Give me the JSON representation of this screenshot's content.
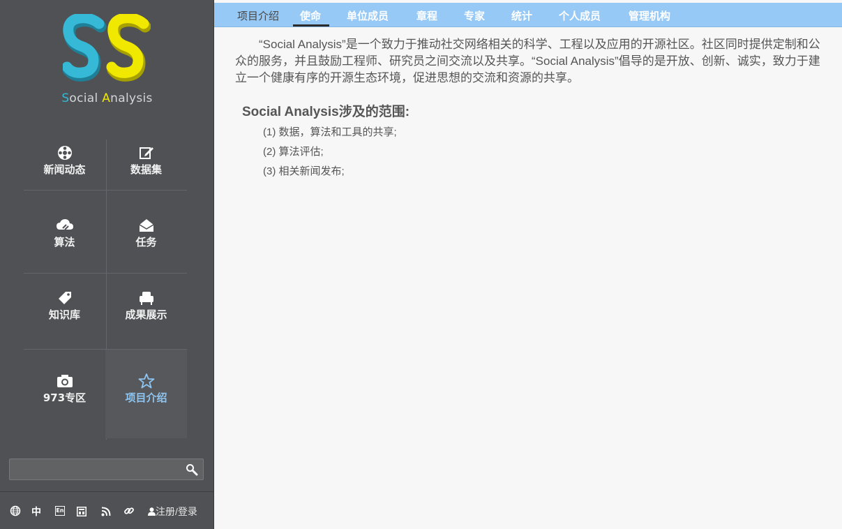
{
  "brand": {
    "logo_letters": "SS",
    "name_parts": [
      "S",
      "ocial ",
      "A",
      "nalysis"
    ],
    "accent_cyan": "#35b9d6",
    "accent_yellow": "#f1e800"
  },
  "sidebar": {
    "tiles": [
      {
        "label": "新闻动态",
        "icon": "film-reel-icon"
      },
      {
        "label": "数据集",
        "icon": "edit-icon"
      },
      {
        "label": "算法",
        "icon": "cloud-sync-icon"
      },
      {
        "label": "任务",
        "icon": "mail-open-icon"
      },
      {
        "label": "知识库",
        "icon": "tag-icon"
      },
      {
        "label": "成果展示",
        "icon": "armchair-icon"
      },
      {
        "label": "973专区",
        "icon": "camera-icon"
      },
      {
        "label": "项目介绍",
        "icon": "star-icon",
        "active": true
      }
    ],
    "search": {
      "placeholder": "",
      "value": ""
    },
    "bottom": {
      "icons": [
        "globe-icon",
        "chinese-lang-icon",
        "english-lang-icon",
        "layout-icon",
        "rss-icon",
        "link-icon"
      ],
      "chinese_label": "中",
      "english_label": "En",
      "login_label": "注册/登录"
    }
  },
  "topnav": {
    "items": [
      "项目介绍",
      "使命",
      "单位成员",
      "章程",
      "专家",
      "统计",
      "个人成员",
      "管理机构"
    ],
    "active": "使命",
    "bg_color": "#96c9f5"
  },
  "content": {
    "intro": "“Social Analysis”是一个致力于推动社交网络相关的科学、工程以及应用的开源社区。社区同时提供定制和公众的服务，并且鼓励工程师、研究员之间交流以及共享。“Social Analysis”倡导的是开放、创新、诚实，致力于建立一个健康有序的开源生态环境，促进思想的交流和资源的共享。",
    "scope_title": "Social Analysis涉及的范围:",
    "scope_items": [
      "(1) 数据，算法和工具的共享;",
      "(2) 算法评估;",
      "(3) 相关新闻发布;"
    ]
  }
}
